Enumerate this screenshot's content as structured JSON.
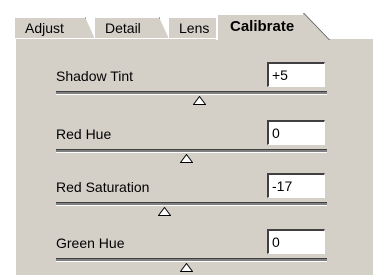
{
  "tabs": [
    {
      "label": "Adjust",
      "active": false
    },
    {
      "label": "Detail",
      "active": false
    },
    {
      "label": "Lens",
      "active": false
    },
    {
      "label": "Calibrate",
      "active": true
    }
  ],
  "controls": [
    {
      "label": "Shadow Tint",
      "value": "+5",
      "level": 0.53
    },
    {
      "label": "Red Hue",
      "value": "0",
      "level": 0.48
    },
    {
      "label": "Red Saturation",
      "value": "-17",
      "level": 0.4
    },
    {
      "label": "Green Hue",
      "value": "0",
      "level": 0.48
    }
  ],
  "colors": {
    "panel": "#d4d0c8",
    "highlight": "#ffffff",
    "shadow": "#404040"
  },
  "icons": {
    "slider_thumb": "triangle-up-icon"
  }
}
